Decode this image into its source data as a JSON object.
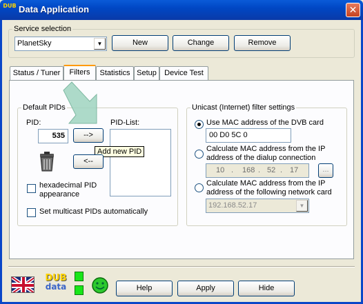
{
  "window": {
    "title": "Data Application",
    "app_icon_text": "DUB",
    "close_glyph": "✕"
  },
  "service": {
    "legend": "Service selection",
    "selected": "PlanetSky",
    "new_label": "New",
    "change_label": "Change",
    "remove_label": "Remove"
  },
  "tabs": [
    {
      "label": "Status / Tuner"
    },
    {
      "label": "Filters"
    },
    {
      "label": "Statistics"
    },
    {
      "label": "Setup"
    },
    {
      "label": "Device Test"
    }
  ],
  "default_pids": {
    "legend": "Default PIDs",
    "pid_label": "PID:",
    "pid_value": "535",
    "add_arrow": "-->",
    "remove_arrow": "<--",
    "pid_list_label": "PID-List:",
    "tooltip": "Add new PID",
    "hex_label": "hexadecimal PID appearance",
    "multicast_label": "Set multicast PIDs automatically"
  },
  "unicast": {
    "legend": "Unicast (Internet) filter settings",
    "opt1_label": "Use MAC address of the DVB card",
    "mac_value": "00 D0 5C 0",
    "opt2_label": "Calculate MAC address from the IP address of the dialup connection",
    "ip_octets": [
      "10",
      "168",
      "52",
      "17"
    ],
    "ip_dot": ".",
    "browse_label": "...",
    "opt3_label": "Calculate MAC address from the IP address of the following network card",
    "card_ip": "192.168.52.17"
  },
  "footer": {
    "logo_top": "DUB",
    "logo_bottom": "data",
    "help_label": "Help",
    "apply_label": "Apply",
    "hide_label": "Hide"
  },
  "colors": {
    "titlebar": "#0a5bd8",
    "led_green": "#19e619",
    "arrow_overlay": "#9fd4c0"
  }
}
